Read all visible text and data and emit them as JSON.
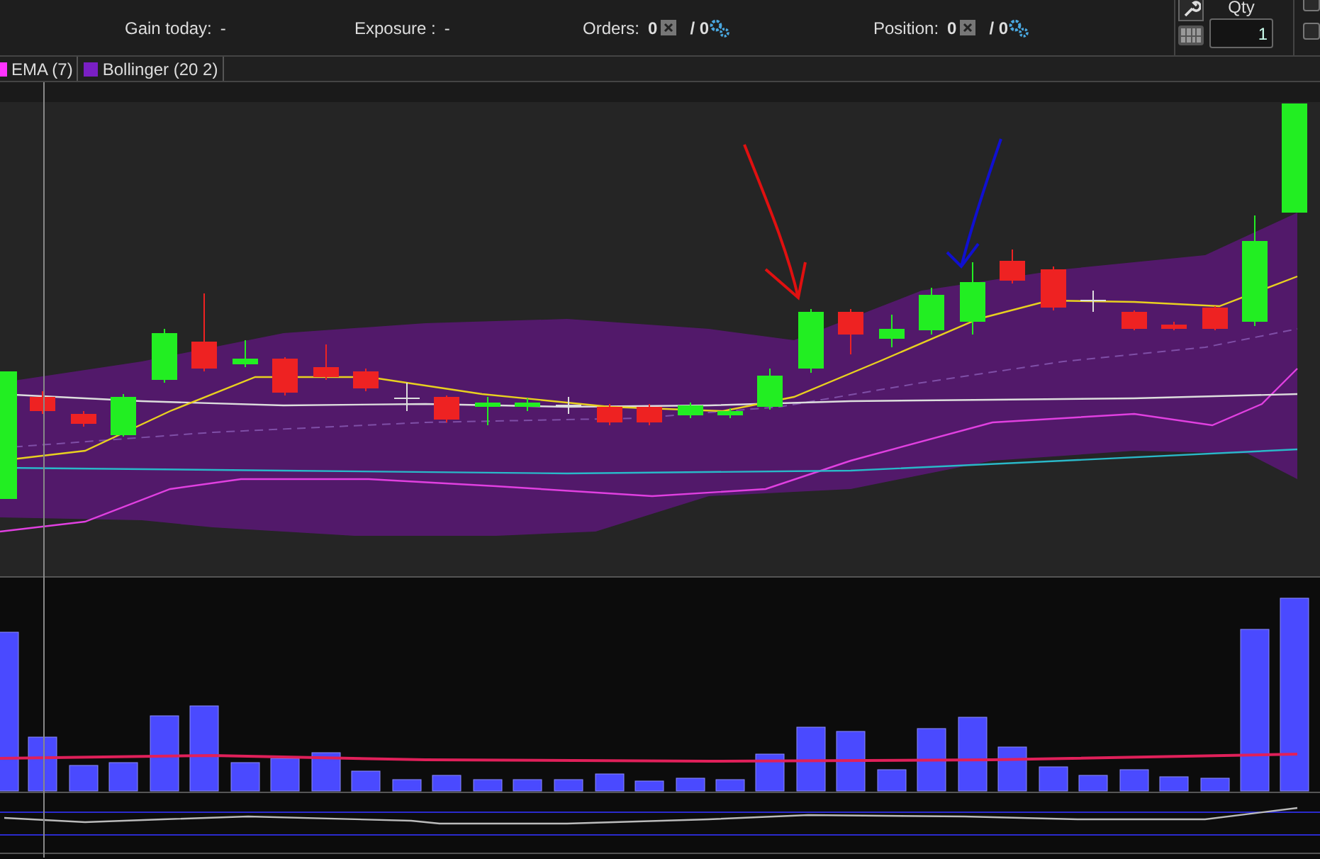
{
  "stats": [
    {
      "kind": "plain",
      "label": "Gain today:",
      "value": "-"
    },
    {
      "kind": "plain",
      "label": "Exposure :",
      "value": "-"
    },
    {
      "kind": "counter",
      "label": "Orders:",
      "value": "0",
      "total": "/ 0"
    },
    {
      "kind": "counter",
      "label": "Position:",
      "value": "0",
      "total": "/ 0"
    }
  ],
  "qty": {
    "label": "Qty",
    "value": "1"
  },
  "checkboxes": [
    {
      "checked": false
    },
    {
      "checked": false
    }
  ],
  "indicators": [
    {
      "label": "EMA (7)",
      "color": "#ff33ff"
    },
    {
      "label": "Bollinger (20 2)",
      "color": "#7a1fc4"
    }
  ]
}
